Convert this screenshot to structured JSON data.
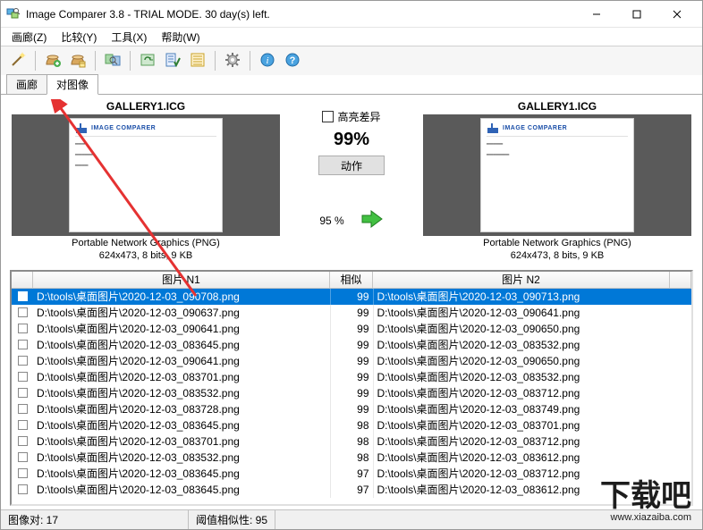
{
  "window": {
    "title": "Image Comparer 3.8 - TRIAL MODE. 30 day(s) left."
  },
  "menus": {
    "gallery": "画廊(Z)",
    "compare": "比较(Y)",
    "tools": "工具(X)",
    "help": "帮助(W)"
  },
  "tabs": {
    "gallery": "画廊",
    "pairs": "对图像"
  },
  "compare": {
    "left_title": "GALLERY1.ICG",
    "right_title": "GALLERY1.ICG",
    "left_format": "Portable Network Graphics (PNG)",
    "left_info": "624x473, 8 bits, 9 KB",
    "right_format": "Portable Network Graphics (PNG)",
    "right_info": "624x473, 8 bits, 9 KB",
    "highlight_label": "高亮差异",
    "similarity_big": "99%",
    "action_button": "动作",
    "slider_value": "95 %",
    "logo_text": "IMAGE COMPARER"
  },
  "table": {
    "headers": {
      "n1": "图片 N1",
      "sim": "相似",
      "n2": "图片 N2"
    },
    "rows": [
      {
        "n1": "D:\\tools\\桌面图片\\2020-12-03_090708.png",
        "sim": 99,
        "n2": "D:\\tools\\桌面图片\\2020-12-03_090713.png",
        "selected": true
      },
      {
        "n1": "D:\\tools\\桌面图片\\2020-12-03_090637.png",
        "sim": 99,
        "n2": "D:\\tools\\桌面图片\\2020-12-03_090641.png"
      },
      {
        "n1": "D:\\tools\\桌面图片\\2020-12-03_090641.png",
        "sim": 99,
        "n2": "D:\\tools\\桌面图片\\2020-12-03_090650.png"
      },
      {
        "n1": "D:\\tools\\桌面图片\\2020-12-03_083645.png",
        "sim": 99,
        "n2": "D:\\tools\\桌面图片\\2020-12-03_083532.png"
      },
      {
        "n1": "D:\\tools\\桌面图片\\2020-12-03_090641.png",
        "sim": 99,
        "n2": "D:\\tools\\桌面图片\\2020-12-03_090650.png"
      },
      {
        "n1": "D:\\tools\\桌面图片\\2020-12-03_083701.png",
        "sim": 99,
        "n2": "D:\\tools\\桌面图片\\2020-12-03_083532.png"
      },
      {
        "n1": "D:\\tools\\桌面图片\\2020-12-03_083532.png",
        "sim": 99,
        "n2": "D:\\tools\\桌面图片\\2020-12-03_083712.png"
      },
      {
        "n1": "D:\\tools\\桌面图片\\2020-12-03_083728.png",
        "sim": 99,
        "n2": "D:\\tools\\桌面图片\\2020-12-03_083749.png"
      },
      {
        "n1": "D:\\tools\\桌面图片\\2020-12-03_083645.png",
        "sim": 98,
        "n2": "D:\\tools\\桌面图片\\2020-12-03_083701.png"
      },
      {
        "n1": "D:\\tools\\桌面图片\\2020-12-03_083701.png",
        "sim": 98,
        "n2": "D:\\tools\\桌面图片\\2020-12-03_083712.png"
      },
      {
        "n1": "D:\\tools\\桌面图片\\2020-12-03_083532.png",
        "sim": 98,
        "n2": "D:\\tools\\桌面图片\\2020-12-03_083612.png"
      },
      {
        "n1": "D:\\tools\\桌面图片\\2020-12-03_083645.png",
        "sim": 97,
        "n2": "D:\\tools\\桌面图片\\2020-12-03_083712.png"
      },
      {
        "n1": "D:\\tools\\桌面图片\\2020-12-03_083645.png",
        "sim": 97,
        "n2": "D:\\tools\\桌面图片\\2020-12-03_083612.png"
      }
    ]
  },
  "status": {
    "pairs": "图像对: 17",
    "threshold": "阈值相似性: 95"
  },
  "watermark": {
    "big": "下载吧",
    "url": "www.xiazaiba.com"
  }
}
